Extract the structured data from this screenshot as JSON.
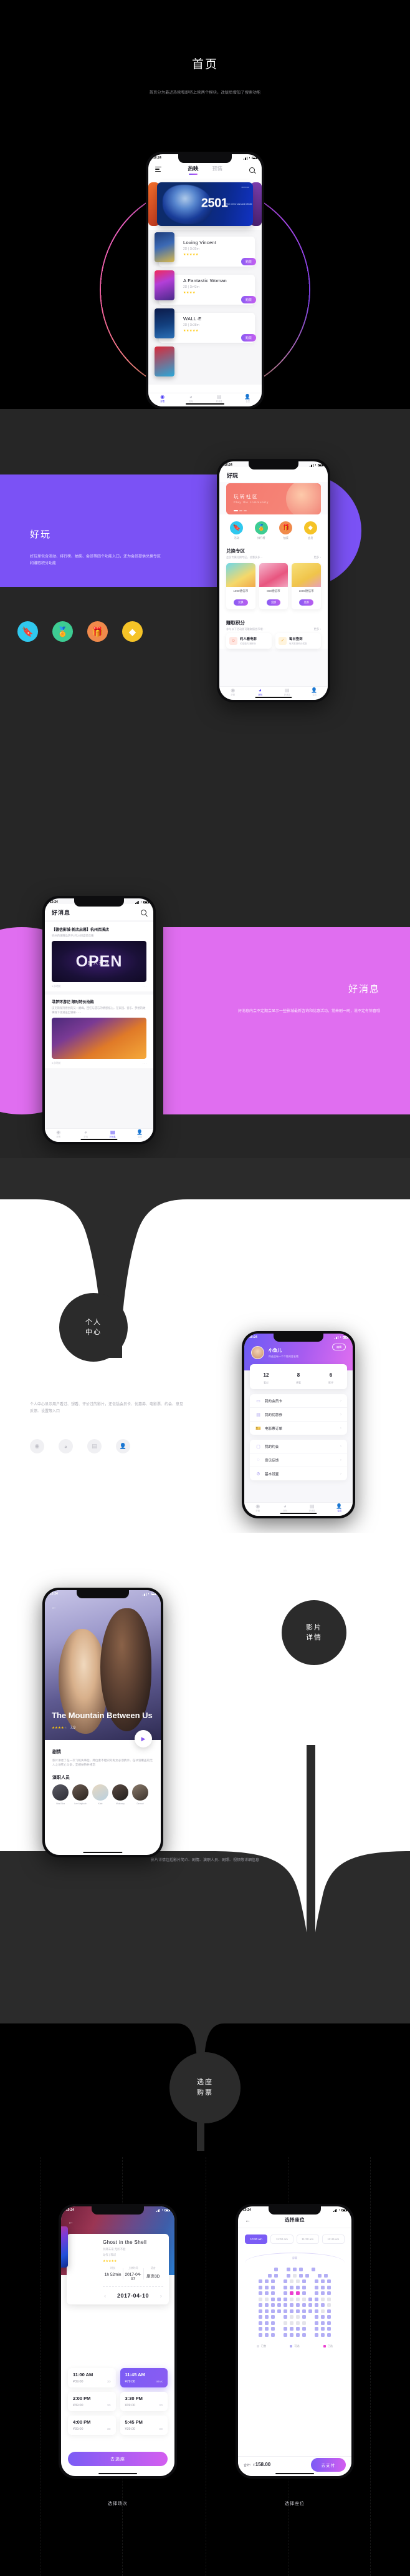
{
  "sections": {
    "home": {
      "title": "首页",
      "subtitle": "首页分为最近热映和即将上映两个模块，改版后增加了搜索功能",
      "phone": {
        "time": "10:24",
        "tabs": [
          {
            "label": "热映",
            "active": true
          },
          {
            "label": "预售",
            "active": false
          }
        ],
        "banner": {
          "number": "2501",
          "tagline": "The net is vast and infinite",
          "date": "06.XX.18"
        },
        "movies": [
          {
            "title": "Loving Vincent",
            "meta": "2D | 1h35m",
            "stars": "★★★★★",
            "buy": "购票"
          },
          {
            "title": "A Fantastic Woman",
            "meta": "2D | 1h43m",
            "stars": "★★★★",
            "buy": "购票"
          },
          {
            "title": "WALL·E",
            "meta": "2D | 1h38m",
            "stars": "★★★★★",
            "buy": "购票"
          }
        ],
        "tabbar": [
          {
            "icon": "film-icon",
            "glyph": "◉",
            "label": "好看",
            "active": true
          },
          {
            "icon": "palette-icon",
            "glyph": "◕",
            "label": "好玩",
            "active": false
          },
          {
            "icon": "news-icon",
            "glyph": "▤",
            "label": "好消息",
            "active": false
          },
          {
            "icon": "user-icon",
            "glyph": "👤",
            "label": "会员",
            "active": false
          }
        ]
      }
    },
    "fun": {
      "title": "好玩",
      "subtitle": "好玩里包含活动、排行榜、抽奖、会员等四个功能入口，还为会员提供兑换专区和赚取积分功能",
      "dots": [
        {
          "icon": "bookmark-icon",
          "glyph": "🔖",
          "color": "#30c8ee"
        },
        {
          "icon": "medal-icon",
          "glyph": "🏅",
          "color": "#3dcc92"
        },
        {
          "icon": "gift-icon",
          "glyph": "🎁",
          "color": "#f08a4b"
        },
        {
          "icon": "diamond-icon",
          "glyph": "◆",
          "color": "#f5c327"
        }
      ],
      "phone": {
        "time": "10:24",
        "title": "好玩",
        "banner": {
          "title": "玩转社区",
          "sub": "Play the community"
        },
        "quick": [
          {
            "label": "活动",
            "glyph": "🔖",
            "color": "#30c8ee"
          },
          {
            "label": "排行榜",
            "glyph": "🏅",
            "color": "#3dcc92"
          },
          {
            "label": "抽奖",
            "glyph": "🎁",
            "color": "#f08a4b"
          },
          {
            "label": "会员",
            "glyph": "◆",
            "color": "#f5c327"
          }
        ],
        "exchange": {
          "title": "兑换专区",
          "sub": "会员专属兑换专区，优惠多多···",
          "more": "更多 ›"
        },
        "goods": [
          {
            "price": "1000德信币",
            "btn": "兑换"
          },
          {
            "price": "800德信币",
            "btn": "兑换"
          },
          {
            "price": "1000德信币",
            "btn": "兑换"
          }
        ],
        "points": {
          "title": "赚取积分",
          "sub": "参与以下活动即可赚取德信币哦···",
          "more": "更多 ›"
        },
        "activities": [
          {
            "title": "约人看电影",
            "sub": "约定邀约 赚积分"
          },
          {
            "title": "每日签到",
            "sub": "每天签到积分奖励"
          }
        ],
        "tabbar": [
          {
            "glyph": "◉",
            "label": "好看",
            "active": false
          },
          {
            "glyph": "◕",
            "label": "好玩",
            "active": true
          },
          {
            "glyph": "▤",
            "label": "好消息",
            "active": false
          },
          {
            "glyph": "👤",
            "label": "会员",
            "active": false
          }
        ]
      }
    },
    "news": {
      "title": "好消息",
      "subtitle": "好消息内会不定期会显示一些影城最新咨询和优惠活动，常来刷一刷，说不定有惊喜哦",
      "phone": {
        "time": "10:24",
        "title": "好消息",
        "items": [
          {
            "title": "【德信影城·新店启幕】杭州西溪店",
            "desc": "杭州西溪精品店于2月24日盛装启幕",
            "badge": "OPEN",
            "badge_cn": "盛大开业",
            "time": "1小时前"
          },
          {
            "title": "寻梦环游记 限时特价抢购",
            "desc": "皮克斯保持原创的又一巅峰。回忆与遗忘的情感核心，在家园、音乐、梦想的故事线下汹涌迸出银幕······",
            "time": "3小时前"
          }
        ],
        "tabbar": [
          {
            "glyph": "◉",
            "label": "好看",
            "active": false
          },
          {
            "glyph": "◕",
            "label": "好玩",
            "active": false
          },
          {
            "glyph": "▤",
            "label": "好消息",
            "active": true
          },
          {
            "glyph": "👤",
            "label": "会员",
            "active": false
          }
        ]
      }
    },
    "profile": {
      "badge_line1": "个人",
      "badge_line2": "中心",
      "subtitle": "个人中心显示用户看过、想看、评价过的影片，还包括会员卡、优惠券、电影票、约会、意见反馈、设置等入口",
      "mini_icons": [
        {
          "icon": "film-icon",
          "glyph": "◉",
          "active": false
        },
        {
          "icon": "palette-icon",
          "glyph": "◕",
          "active": false
        },
        {
          "icon": "news-icon",
          "glyph": "▤",
          "active": false
        },
        {
          "icon": "user-icon",
          "glyph": "👤",
          "active": true
        }
      ],
      "phone": {
        "time": "10:24",
        "user": {
          "name": "小鱼儿",
          "signature": "你还没有一个个性的签名哦",
          "edit": "编辑"
        },
        "stats": [
          {
            "value": "12",
            "label": "看过"
          },
          {
            "value": "8",
            "label": "想看"
          },
          {
            "value": "6",
            "label": "影评"
          }
        ],
        "menu_group_1": [
          {
            "icon": "card-icon",
            "glyph": "▭",
            "label": "我的会员卡",
            "chevron": "›"
          },
          {
            "icon": "coupon-icon",
            "glyph": "▤",
            "label": "我的优惠券",
            "chevron": "›"
          },
          {
            "icon": "ticket-icon",
            "glyph": "🎫",
            "label": "电影票订单",
            "chevron": "›"
          }
        ],
        "menu_group_2": [
          {
            "icon": "chat-icon",
            "glyph": "▢",
            "label": "我的约会",
            "chevron": "›"
          },
          {
            "icon": "bulb-icon",
            "glyph": "◌",
            "label": "意见反馈",
            "chevron": "›"
          },
          {
            "icon": "gear-icon",
            "glyph": "⚙",
            "label": "基本设置",
            "chevron": "›"
          }
        ],
        "tabbar": [
          {
            "glyph": "◉",
            "label": "好看",
            "active": false
          },
          {
            "glyph": "◕",
            "label": "好玩",
            "active": false
          },
          {
            "glyph": "▤",
            "label": "好消息",
            "active": false
          },
          {
            "glyph": "👤",
            "label": "会员",
            "active": true
          }
        ]
      }
    },
    "detail": {
      "badge_line1": "影片",
      "badge_line2": "详情",
      "subtitle": "影片详情包括影片简介、剧情、演职人员、剧照、视频等详细信息",
      "phone": {
        "time": "10:24",
        "back": "←",
        "movie_title": "The Mountain Between Us",
        "stars": "★★★★",
        "star_dim": "★",
        "score": "7.9",
        "play": "▶",
        "plot_heading": "剧情",
        "plot": "影片讲述了在一次飞机失事后，两位素不相识的男女必须携手，在冰雪覆盖的无人之地死亡斗争，互相扶持并相恋",
        "crew_heading": "演职人员",
        "crew": [
          "Idris Elba",
          "Lee Majdoub",
          "Kate",
          "Mulroney",
          "Dermot"
        ]
      }
    },
    "booking": {
      "badge_line1": "选座",
      "badge_line2": "购票",
      "caption_left": "选择场次",
      "caption_right": "选择座位",
      "session": {
        "time": "10:24",
        "back": "←",
        "title": "Ghost in the Shell",
        "sub1": "玩转未来 无所不能",
        "sub2": "动作 | 科幻",
        "stars": "★★★★★",
        "meta": [
          {
            "key": "时长",
            "value": "1h 52min"
          },
          {
            "key": "上映时间",
            "value": "2017-04-07"
          },
          {
            "key": "语言",
            "value": "原声3D"
          }
        ],
        "date": "2017-04-10",
        "prev": "‹",
        "next": "›",
        "slots": [
          {
            "time": "11:00 AM",
            "price": "¥39.00",
            "format": "3D",
            "selected": false
          },
          {
            "time": "11:45 AM",
            "price": "¥79.00",
            "format": "IMAX",
            "selected": true
          },
          {
            "time": "2:00 PM",
            "price": "¥39.00",
            "format": "3D",
            "selected": false
          },
          {
            "time": "3:30 PM",
            "price": "¥39.00",
            "format": "3D",
            "selected": false
          },
          {
            "time": "4:00 PM",
            "price": "¥39.00",
            "format": "3D",
            "selected": false
          },
          {
            "time": "5:45 PM",
            "price": "¥39.00",
            "format": "3D",
            "selected": false
          }
        ],
        "cta": "去选座"
      },
      "seats": {
        "time": "10:24",
        "back": "←",
        "title": "选择座位",
        "time_chips": [
          {
            "label": "10:30 am",
            "selected": true
          },
          {
            "label": "11:00 am",
            "selected": false
          },
          {
            "label": "11:30 am",
            "selected": false
          },
          {
            "label": "11:45 am",
            "selected": false
          }
        ],
        "screen_label": "屏幕",
        "legend": [
          {
            "label": "已售",
            "color": "#e4e4ea"
          },
          {
            "label": "可选",
            "color": "#b3aef5"
          },
          {
            "label": "已选",
            "color": "#ec3fd0"
          }
        ],
        "total_label": "合计：¥",
        "total_value": "158.00",
        "pay": "去支付",
        "grid": [
          [
            "n",
            "n",
            "a",
            "n",
            "a",
            "a",
            "a",
            "n",
            "a",
            "n",
            "n"
          ],
          [
            "n",
            "a",
            "a",
            "n",
            "a",
            "x",
            "a",
            "a",
            "n",
            "a",
            "a"
          ],
          [
            "a",
            "a",
            "a",
            "n",
            "a",
            "x",
            "x",
            "a",
            "n",
            "a",
            "a",
            "a"
          ],
          [
            "a",
            "a",
            "a",
            "n",
            "a",
            "a",
            "a",
            "a",
            "n",
            "a",
            "a",
            "a"
          ],
          [
            "a",
            "a",
            "a",
            "n",
            "a",
            "s",
            "s",
            "a",
            "n",
            "a",
            "a",
            "a"
          ],
          [
            "x",
            "x",
            "a",
            "a",
            "a",
            "x",
            "x",
            "x",
            "a",
            "a",
            "x",
            "x"
          ],
          [
            "a",
            "a",
            "a",
            "a",
            "a",
            "a",
            "a",
            "a",
            "a",
            "a",
            "a",
            "x"
          ],
          [
            "a",
            "a",
            "a",
            "a",
            "a",
            "a",
            "a",
            "a",
            "a",
            "a",
            "x",
            "a"
          ],
          [
            "a",
            "a",
            "a",
            "n",
            "a",
            "x",
            "x",
            "a",
            "n",
            "a",
            "a",
            "a"
          ],
          [
            "a",
            "a",
            "a",
            "n",
            "x",
            "x",
            "x",
            "x",
            "n",
            "a",
            "a",
            "a"
          ],
          [
            "a",
            "a",
            "a",
            "n",
            "a",
            "a",
            "a",
            "a",
            "n",
            "a",
            "a",
            "a"
          ],
          [
            "a",
            "a",
            "a",
            "n",
            "a",
            "a",
            "a",
            "a",
            "n",
            "a",
            "a",
            "a"
          ]
        ]
      }
    }
  }
}
